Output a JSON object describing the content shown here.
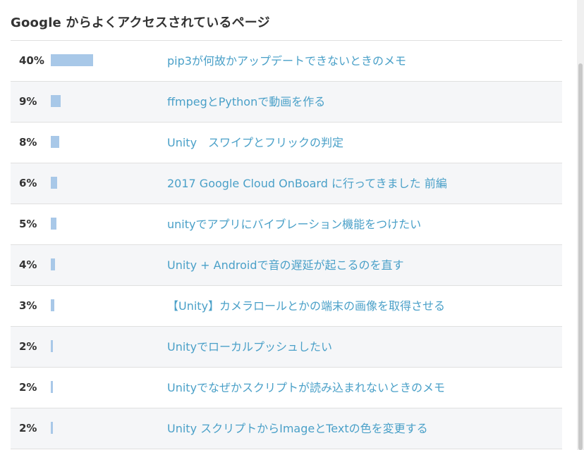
{
  "heading": "Google からよくアクセスされているページ",
  "colors": {
    "bar": "#a8c8e8",
    "link": "#4aa0c8",
    "row_alt": "#f5f6f8"
  },
  "rows": [
    {
      "percent": "40%",
      "share": 40,
      "title": "pip3が何故かアップデートできないときのメモ"
    },
    {
      "percent": "9%",
      "share": 9,
      "title": "ffmpegとPythonで動画を作る"
    },
    {
      "percent": "8%",
      "share": 8,
      "title": "Unity　スワイプとフリックの判定"
    },
    {
      "percent": "6%",
      "share": 6,
      "title": "2017 Google Cloud OnBoard に行ってきました 前編"
    },
    {
      "percent": "5%",
      "share": 5,
      "title": "unityでアプリにバイブレーション機能をつけたい"
    },
    {
      "percent": "4%",
      "share": 4,
      "title": "Unity + Androidで音の遅延が起こるのを直す"
    },
    {
      "percent": "3%",
      "share": 3,
      "title": "【Unity】カメラロールとかの端末の画像を取得させる"
    },
    {
      "percent": "2%",
      "share": 2,
      "title": "Unityでローカルプッシュしたい"
    },
    {
      "percent": "2%",
      "share": 2,
      "title": "Unityでなぜかスクリプトが読み込まれないときのメモ"
    },
    {
      "percent": "2%",
      "share": 2,
      "title": "Unity スクリプトからImageとTextの色を変更する"
    }
  ]
}
